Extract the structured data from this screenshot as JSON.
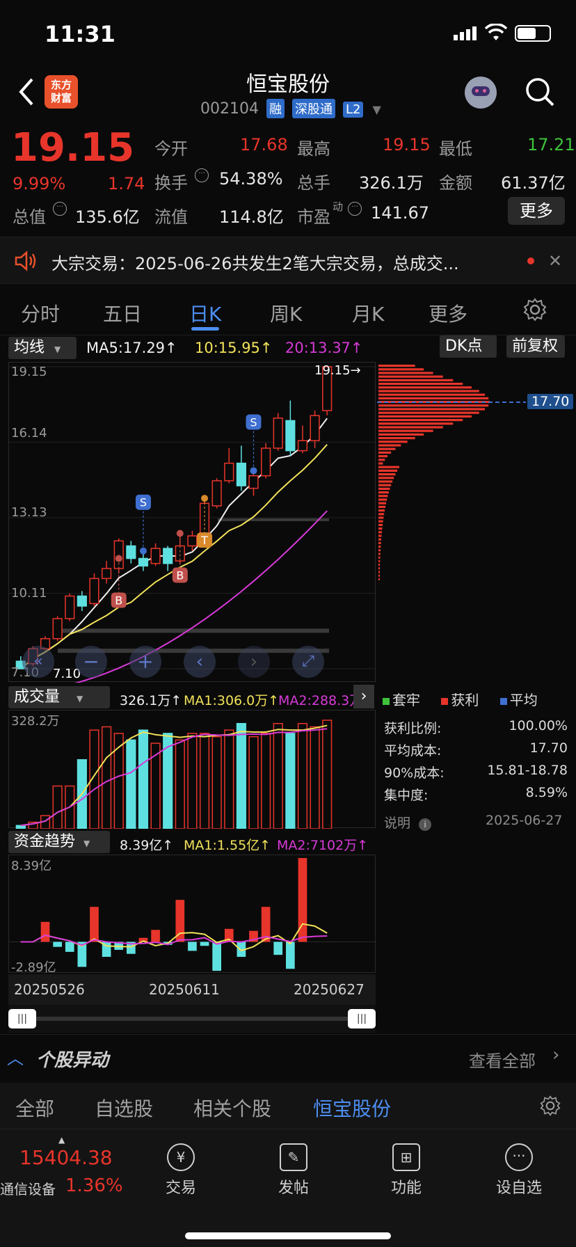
{
  "status_bar": {
    "time": "11:31"
  },
  "header": {
    "title": "恒宝股份",
    "code": "002104",
    "tags": [
      "融",
      "深股通",
      "L2"
    ],
    "logo_text_line1": "东方",
    "logo_text_line2": "财富"
  },
  "quote": {
    "price": "19.15",
    "change_pct": "9.99%",
    "change": "1.74",
    "open_label": "今开",
    "open": "17.68",
    "high_label": "最高",
    "high": "19.15",
    "low_label": "最低",
    "low": "17.21",
    "turnover_label": "换手",
    "turnover": "54.38%",
    "volume_label": "总手",
    "volume": "326.1万",
    "amount_label": "金额",
    "amount": "61.37亿",
    "total_cap_label": "总值",
    "total_cap": "135.6亿",
    "float_cap_label": "流值",
    "float_cap": "114.8亿",
    "pe_label": "市盈",
    "pe_sup": "动",
    "pe": "141.67",
    "more_label": "更多"
  },
  "notice": {
    "text": "大宗交易：2025-06-26共发生2笔大宗交易，总成交..."
  },
  "tabs": {
    "t1": "分时",
    "t2": "五日",
    "t3": "日K",
    "t4": "周K",
    "t5": "月K",
    "t6": "更多"
  },
  "kline": {
    "indicator_label": "均线",
    "ma5": "MA5:17.29↑",
    "ma10": "10:15.95↑",
    "ma20": "20:13.37↑",
    "dk_label": "DK点",
    "adjust_label": "前复权",
    "y_labels": [
      "19.15",
      "16.14",
      "13.13",
      "10.11",
      "7.10"
    ],
    "max_label": "19.15→",
    "min_label": "7.10",
    "chip_price": "17.70",
    "markers": {
      "s1": "S",
      "s2": "S",
      "b1": "B",
      "b2": "B",
      "t1": "T"
    }
  },
  "chart_data": {
    "type": "candlestick",
    "candles": [
      {
        "o": 7.4,
        "c": 7.1,
        "h": 7.6,
        "l": 7.1
      },
      {
        "o": 7.3,
        "c": 7.9,
        "h": 8.0,
        "l": 7.2
      },
      {
        "o": 7.9,
        "c": 8.3,
        "h": 8.4,
        "l": 7.8
      },
      {
        "o": 8.3,
        "c": 9.1,
        "h": 9.2,
        "l": 8.2
      },
      {
        "o": 9.1,
        "c": 10.0,
        "h": 10.1,
        "l": 9.0
      },
      {
        "o": 10.0,
        "c": 9.6,
        "h": 10.2,
        "l": 9.4
      },
      {
        "o": 9.7,
        "c": 10.7,
        "h": 10.9,
        "l": 9.6
      },
      {
        "o": 10.7,
        "c": 11.1,
        "h": 11.4,
        "l": 10.5
      },
      {
        "o": 11.1,
        "c": 12.2,
        "h": 12.3,
        "l": 10.9
      },
      {
        "o": 12.0,
        "c": 11.5,
        "h": 12.2,
        "l": 11.3
      },
      {
        "o": 11.5,
        "c": 11.2,
        "h": 11.8,
        "l": 11.0
      },
      {
        "o": 11.3,
        "c": 11.9,
        "h": 12.1,
        "l": 11.2
      },
      {
        "o": 11.9,
        "c": 11.3,
        "h": 12.0,
        "l": 11.0
      },
      {
        "o": 11.4,
        "c": 12.0,
        "h": 12.6,
        "l": 11.3
      },
      {
        "o": 12.0,
        "c": 12.4,
        "h": 12.6,
        "l": 11.8
      },
      {
        "o": 12.5,
        "c": 13.7,
        "h": 13.9,
        "l": 12.4
      },
      {
        "o": 13.6,
        "c": 14.6,
        "h": 14.7,
        "l": 13.5
      },
      {
        "o": 14.6,
        "c": 15.3,
        "h": 15.9,
        "l": 14.5
      },
      {
        "o": 15.3,
        "c": 14.4,
        "h": 16.0,
        "l": 14.2
      },
      {
        "o": 14.3,
        "c": 14.8,
        "h": 15.1,
        "l": 14.0
      },
      {
        "o": 14.8,
        "c": 15.9,
        "h": 16.1,
        "l": 14.7
      },
      {
        "o": 15.9,
        "c": 17.1,
        "h": 17.3,
        "l": 15.8
      },
      {
        "o": 17.0,
        "c": 15.8,
        "h": 17.8,
        "l": 15.6
      },
      {
        "o": 15.8,
        "c": 16.2,
        "h": 16.8,
        "l": 15.7
      },
      {
        "o": 16.2,
        "c": 17.2,
        "h": 17.4,
        "l": 15.9
      },
      {
        "o": 17.4,
        "c": 19.15,
        "h": 19.15,
        "l": 17.21
      }
    ],
    "volume_series": [
      0.1,
      0.2,
      0.4,
      1.3,
      1.3,
      2.1,
      3.0,
      3.1,
      2.9,
      2.7,
      3.0,
      2.6,
      2.9,
      2.7,
      2.9,
      2.9,
      2.8,
      3.0,
      3.2,
      2.8,
      2.9,
      3.2,
      2.9,
      3.2,
      3.1,
      3.3
    ],
    "fund_series": [
      0.0,
      0.0,
      2.0,
      -0.5,
      -1.0,
      -2.5,
      3.5,
      -1.5,
      -0.8,
      -1.2,
      0.4,
      1.2,
      -0.3,
      4.2,
      -0.9,
      -0.4,
      -2.9,
      1.3,
      -1.5,
      1.1,
      3.5,
      -1.3,
      -2.7,
      8.39,
      0,
      0
    ]
  },
  "volume": {
    "label": "成交量",
    "value": "326.1万↑",
    "ma1": "MA1:306.0万↑",
    "ma2": "MA2:288.3万",
    "y_top": "328.2万"
  },
  "fund": {
    "label": "资金趋势",
    "value": "8.39亿↑",
    "ma1": "MA1:1.55亿↑",
    "ma2": "MA2:7102万↑",
    "y_top": "8.39亿",
    "y_bottom": "-2.89亿",
    "dates": [
      "20250526",
      "20250611",
      "20250627"
    ]
  },
  "chips": {
    "legend": [
      "套牢",
      "获利",
      "平均"
    ],
    "rows": [
      {
        "k": "获利比例:",
        "v": "100.00%"
      },
      {
        "k": "平均成本:",
        "v": "17.70"
      },
      {
        "k": "90%成本:",
        "v": "15.81-18.78"
      },
      {
        "k": "集中度:",
        "v": "8.59%"
      }
    ],
    "note_label": "说明",
    "date": "2025-06-27"
  },
  "movement": {
    "title": "个股异动",
    "view_all": "查看全部"
  },
  "bottom_tabs": {
    "t1": "全部",
    "t2": "自选股",
    "t3": "相关个股",
    "t4": "恒宝股份"
  },
  "footer": {
    "index_value": "15404.38",
    "index_name": "通信设备",
    "index_pct": "1.36%",
    "items": [
      "交易",
      "发帖",
      "功能",
      "设自选"
    ]
  }
}
